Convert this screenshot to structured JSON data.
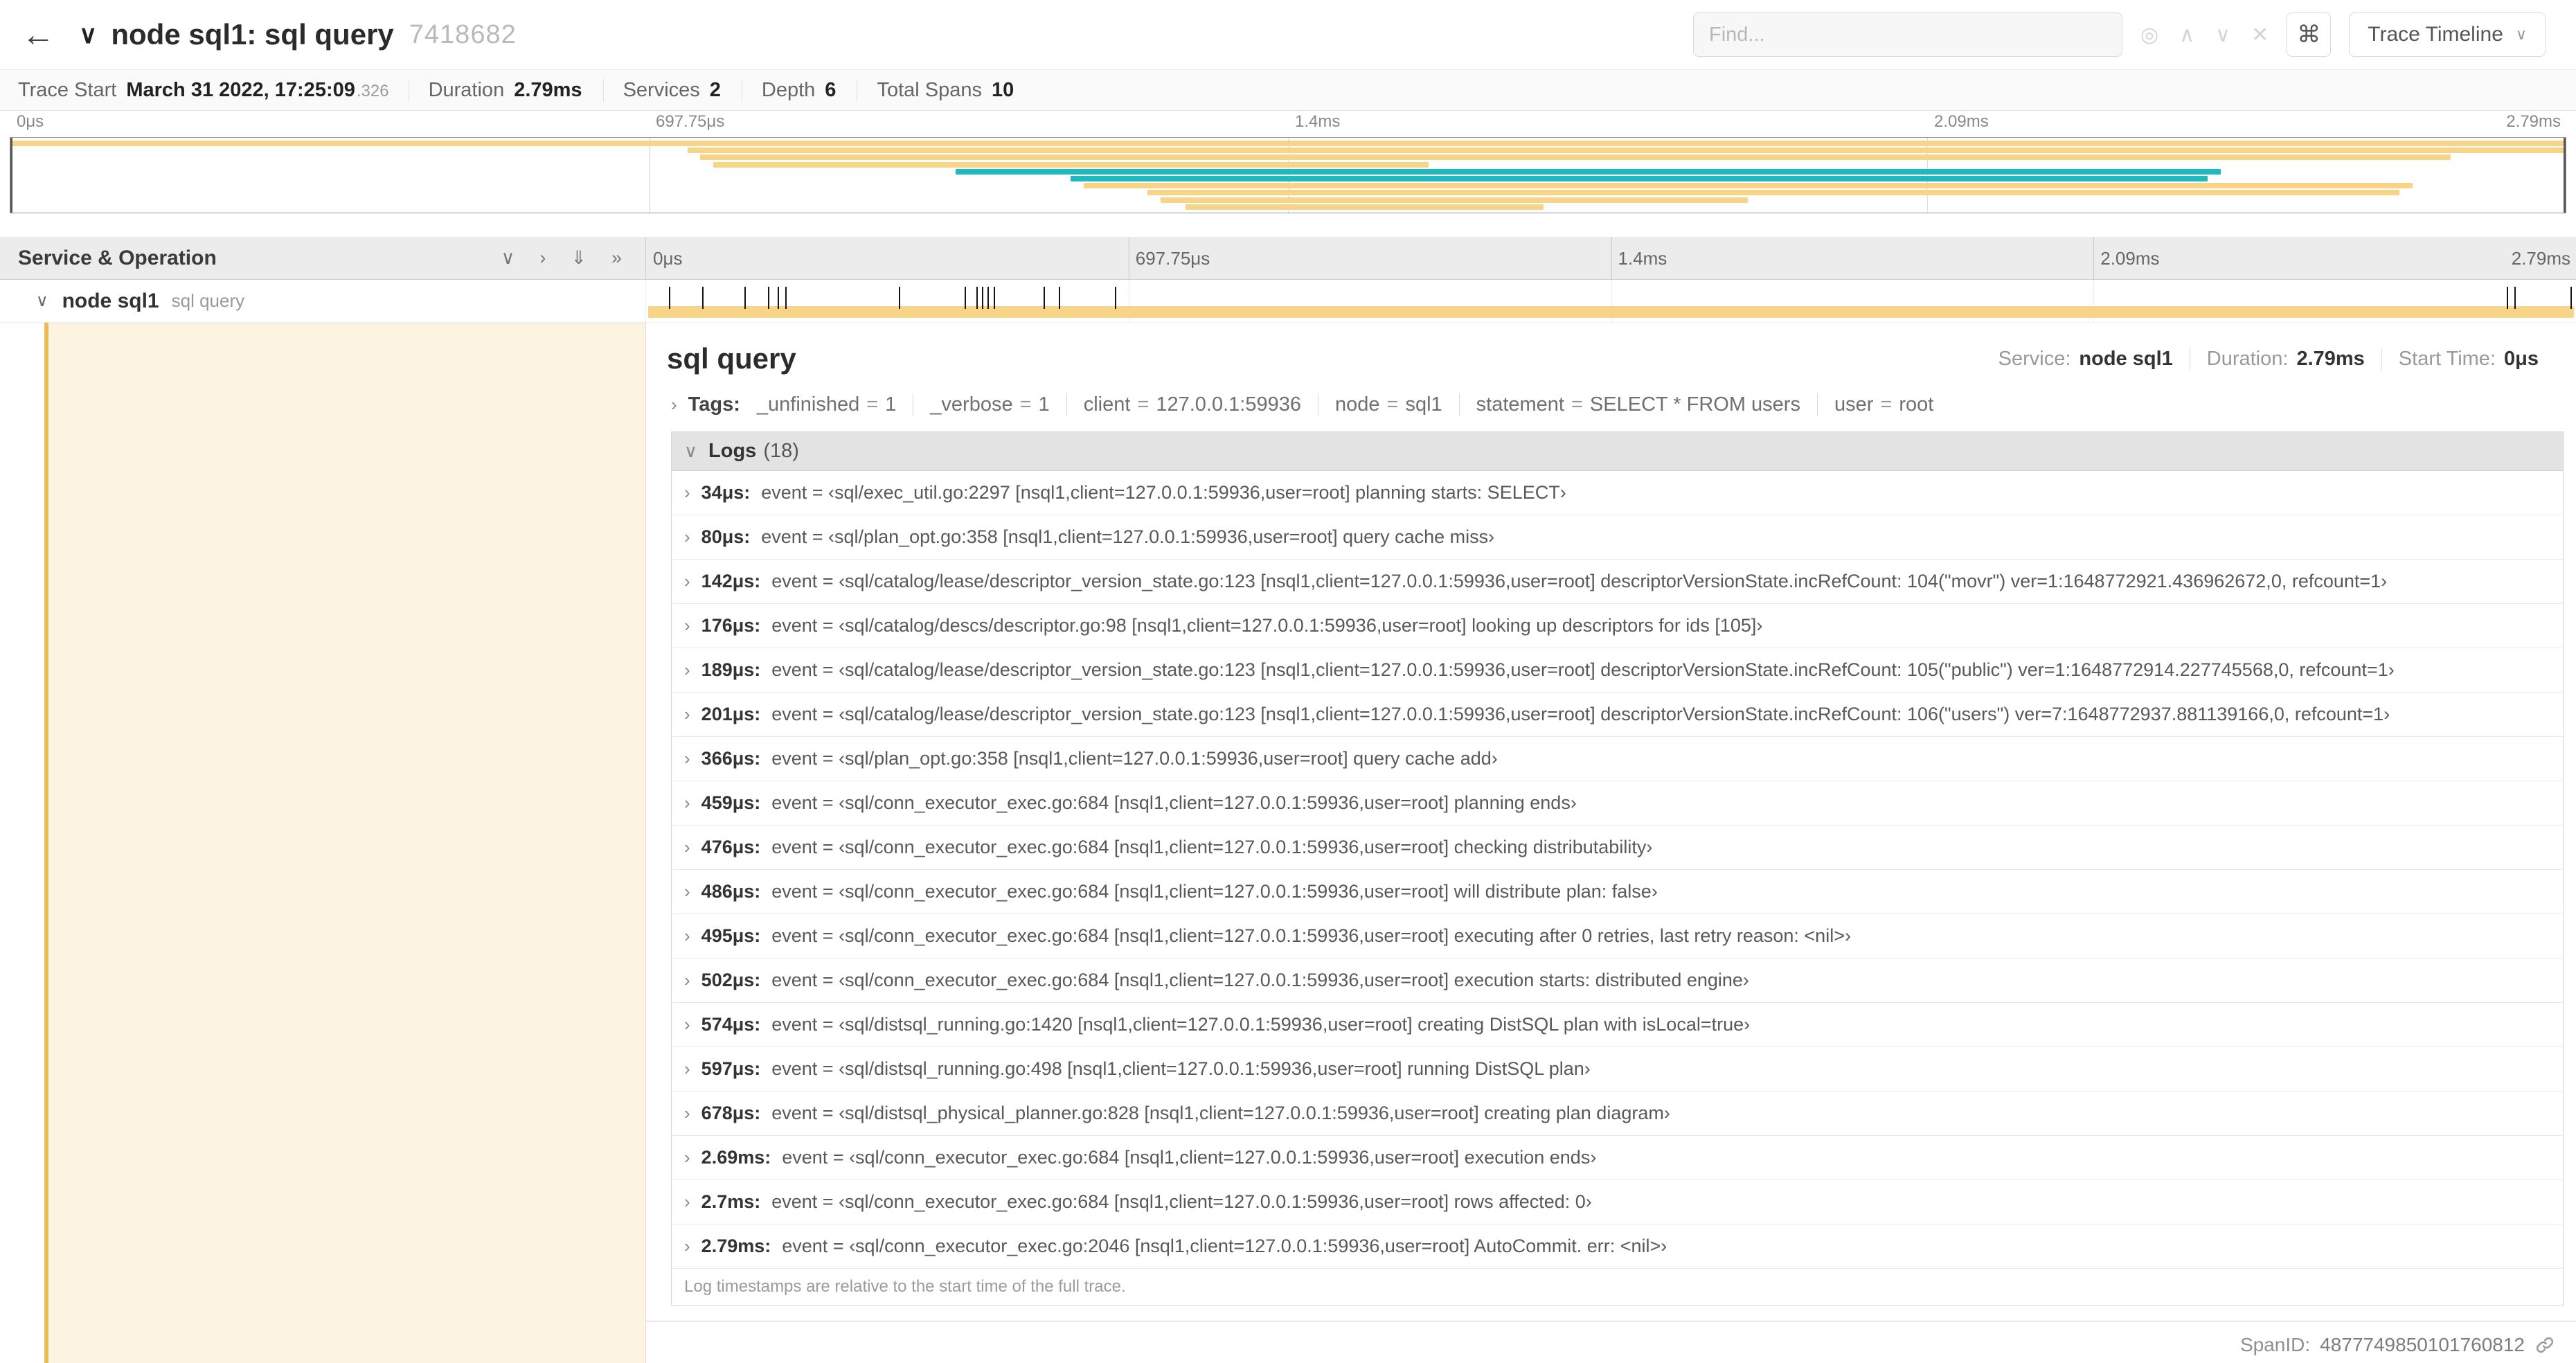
{
  "colors": {
    "tan": "#f8d488",
    "teal": "#1fb8be",
    "selected_row_tint": "#fcf4e0",
    "span_accent": "#e9bd55"
  },
  "symbols": {
    "eq": "="
  },
  "icons": {
    "back": "←",
    "title_chevron": "∨",
    "chevron_down": "∨",
    "chevron_right": "›",
    "double_chevron_down": "⇓",
    "double_chevron_right": "»",
    "find_focus": "◎",
    "prev_result": "∧",
    "next_result": "∨",
    "clear_search": "✕",
    "keyboard_shortcut": "⌘",
    "dropdown_caret": "∨"
  },
  "header": {
    "title": "node sql1: sql query",
    "trace_id": "7418682",
    "find_placeholder": "Find...",
    "view_button": "Trace Timeline"
  },
  "summary": {
    "items": [
      {
        "label": "Trace Start",
        "value": "March 31 2022, 17:25:09",
        "suffix": ".326"
      },
      {
        "label": "Duration",
        "value": "2.79ms",
        "suffix": ""
      },
      {
        "label": "Services",
        "value": "2",
        "suffix": ""
      },
      {
        "label": "Depth",
        "value": "6",
        "suffix": ""
      },
      {
        "label": "Total Spans",
        "value": "10",
        "suffix": ""
      }
    ]
  },
  "minimap": {
    "ticks": [
      "0μs",
      "697.75μs",
      "1.4ms",
      "2.09ms",
      "2.79ms"
    ],
    "spans": [
      {
        "start": 0,
        "end": 100,
        "color": "tan"
      },
      {
        "start": 26.5,
        "end": 100,
        "color": "tan"
      },
      {
        "start": 27,
        "end": 95.5,
        "color": "tan"
      },
      {
        "start": 27.5,
        "end": 55.5,
        "color": "tan"
      },
      {
        "start": 37,
        "end": 86.5,
        "color": "teal"
      },
      {
        "start": 41.5,
        "end": 86,
        "color": "teal"
      },
      {
        "start": 42,
        "end": 94,
        "color": "tan"
      },
      {
        "start": 44.5,
        "end": 93.5,
        "color": "tan"
      },
      {
        "start": 45,
        "end": 68,
        "color": "tan"
      },
      {
        "start": 46,
        "end": 60,
        "color": "tan"
      }
    ]
  },
  "timeline": {
    "left_header": "Service & Operation",
    "ruler_ticks": [
      "0μs",
      "697.75μs",
      "1.4ms",
      "2.09ms",
      "2.79ms"
    ],
    "row": {
      "service": "node sql1",
      "operation": "sql query"
    },
    "log_tick_positions_pct": [
      1.2,
      2.9,
      5.1,
      6.3,
      6.8,
      7.2,
      13.1,
      16.5,
      17.1,
      17.4,
      17.7,
      18.0,
      20.6,
      21.4,
      24.3,
      96.4,
      96.8,
      99.7
    ]
  },
  "detail": {
    "title": "sql query",
    "overview": [
      {
        "label": "Service:",
        "value": "node sql1"
      },
      {
        "label": "Duration:",
        "value": "2.79ms"
      },
      {
        "label": "Start Time:",
        "value": "0μs"
      }
    ],
    "tags_label": "Tags:",
    "tags": [
      {
        "key": "_unfinished",
        "value": "1"
      },
      {
        "key": "_verbose",
        "value": "1"
      },
      {
        "key": "client",
        "value": "127.0.0.1:59936"
      },
      {
        "key": "node",
        "value": "sql1"
      },
      {
        "key": "statement",
        "value": "SELECT * FROM users"
      },
      {
        "key": "user",
        "value": "root"
      }
    ],
    "logs_label": "Logs",
    "logs_count": "(18)",
    "logs": [
      {
        "time": "34μs:",
        "text": "event = ‹sql/exec_util.go:2297 [nsql1,client=127.0.0.1:59936,user=root] planning starts: SELECT›"
      },
      {
        "time": "80μs:",
        "text": "event = ‹sql/plan_opt.go:358 [nsql1,client=127.0.0.1:59936,user=root] query cache miss›"
      },
      {
        "time": "142μs:",
        "text": "event = ‹sql/catalog/lease/descriptor_version_state.go:123 [nsql1,client=127.0.0.1:59936,user=root] descriptorVersionState.incRefCount: 104(\"movr\") ver=1:1648772921.436962672,0, refcount=1›"
      },
      {
        "time": "176μs:",
        "text": "event = ‹sql/catalog/descs/descriptor.go:98 [nsql1,client=127.0.0.1:59936,user=root] looking up descriptors for ids [105]›"
      },
      {
        "time": "189μs:",
        "text": "event = ‹sql/catalog/lease/descriptor_version_state.go:123 [nsql1,client=127.0.0.1:59936,user=root] descriptorVersionState.incRefCount: 105(\"public\") ver=1:1648772914.227745568,0, refcount=1›"
      },
      {
        "time": "201μs:",
        "text": "event = ‹sql/catalog/lease/descriptor_version_state.go:123 [nsql1,client=127.0.0.1:59936,user=root] descriptorVersionState.incRefCount: 106(\"users\") ver=7:1648772937.881139166,0, refcount=1›"
      },
      {
        "time": "366μs:",
        "text": "event = ‹sql/plan_opt.go:358 [nsql1,client=127.0.0.1:59936,user=root] query cache add›"
      },
      {
        "time": "459μs:",
        "text": "event = ‹sql/conn_executor_exec.go:684 [nsql1,client=127.0.0.1:59936,user=root] planning ends›"
      },
      {
        "time": "476μs:",
        "text": "event = ‹sql/conn_executor_exec.go:684 [nsql1,client=127.0.0.1:59936,user=root] checking distributability›"
      },
      {
        "time": "486μs:",
        "text": "event = ‹sql/conn_executor_exec.go:684 [nsql1,client=127.0.0.1:59936,user=root] will distribute plan: false›"
      },
      {
        "time": "495μs:",
        "text": "event = ‹sql/conn_executor_exec.go:684 [nsql1,client=127.0.0.1:59936,user=root] executing after 0 retries, last retry reason: <nil>›"
      },
      {
        "time": "502μs:",
        "text": "event = ‹sql/conn_executor_exec.go:684 [nsql1,client=127.0.0.1:59936,user=root] execution starts: distributed engine›"
      },
      {
        "time": "574μs:",
        "text": "event = ‹sql/distsql_running.go:1420 [nsql1,client=127.0.0.1:59936,user=root] creating DistSQL plan with isLocal=true›"
      },
      {
        "time": "597μs:",
        "text": "event = ‹sql/distsql_running.go:498 [nsql1,client=127.0.0.1:59936,user=root] running DistSQL plan›"
      },
      {
        "time": "678μs:",
        "text": "event = ‹sql/distsql_physical_planner.go:828 [nsql1,client=127.0.0.1:59936,user=root] creating plan diagram›"
      },
      {
        "time": "2.69ms:",
        "text": "event = ‹sql/conn_executor_exec.go:684 [nsql1,client=127.0.0.1:59936,user=root] execution ends›"
      },
      {
        "time": "2.7ms:",
        "text": "event = ‹sql/conn_executor_exec.go:684 [nsql1,client=127.0.0.1:59936,user=root] rows affected: 0›"
      },
      {
        "time": "2.79ms:",
        "text": "event = ‹sql/conn_executor_exec.go:2046 [nsql1,client=127.0.0.1:59936,user=root] AutoCommit. err: <nil>›"
      }
    ],
    "logs_footer": "Log timestamps are relative to the start time of the full trace.",
    "span_id_label": "SpanID:",
    "span_id": "4877749850101760812"
  }
}
